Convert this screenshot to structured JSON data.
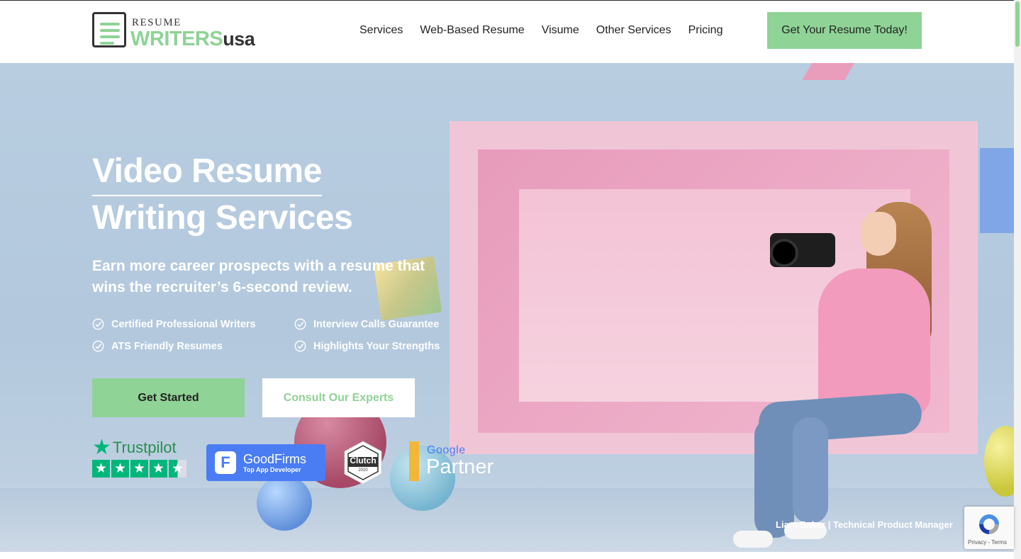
{
  "header": {
    "logo": {
      "top": "RESUME",
      "main": "WRITERS",
      "suffix": "usa"
    },
    "nav": [
      {
        "label": "Services"
      },
      {
        "label": "Web-Based Resume"
      },
      {
        "label": "Visume"
      },
      {
        "label": "Other Services"
      },
      {
        "label": "Pricing"
      }
    ],
    "cta_label": "Get Your Resume Today!"
  },
  "hero": {
    "title_line1": "Video Resume",
    "title_line2": "Writing Services",
    "subtitle": "Earn more career prospects with a resume that wins the recruiter’s 6-second review.",
    "features": [
      "Certified Professional Writers",
      "Interview Calls Guarantee",
      "ATS Friendly Resumes",
      "Highlights Your Strengths"
    ],
    "primary_button": "Get Started",
    "secondary_button": "Consult Our Experts",
    "caption": "Liam Baker | Technical Product Manager"
  },
  "badges": {
    "trustpilot": {
      "name": "Trustpilot",
      "rating": 4.5
    },
    "goodfirms": {
      "name": "GoodFirms",
      "tagline": "Top App Developer"
    },
    "clutch": {
      "name": "Clutch",
      "year": "2020"
    },
    "google_partner": {
      "google": "Google",
      "partner": "Partner"
    }
  },
  "recaptcha": {
    "links": "Privacy - Terms"
  },
  "colors": {
    "accent": "#8fd396",
    "text": "#222222",
    "goodfirms": "#4a7cf3",
    "trustpilot": "#00b67a"
  }
}
